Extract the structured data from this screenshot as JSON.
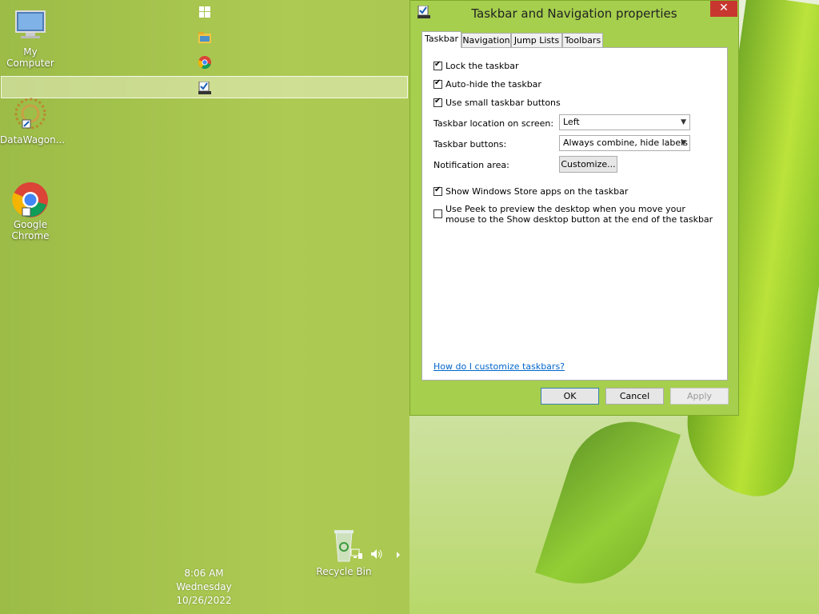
{
  "desktop": {
    "icons": [
      {
        "label": "My Computer"
      },
      {
        "label": "DataWagon..."
      },
      {
        "label": "Google Chrome"
      },
      {
        "label": "Recycle Bin"
      }
    ]
  },
  "taskbar": {
    "clock": {
      "time": "8:06 AM",
      "day": "Wednesday",
      "date": "10/26/2022"
    }
  },
  "dialog": {
    "title": "Taskbar and Navigation properties",
    "close_label": "✕",
    "tabs": [
      {
        "label": "Taskbar"
      },
      {
        "label": "Navigation"
      },
      {
        "label": "Jump Lists"
      },
      {
        "label": "Toolbars"
      }
    ],
    "options": {
      "lock": {
        "label": "Lock the taskbar",
        "checked": true
      },
      "autohide": {
        "label": "Auto-hide the taskbar",
        "checked": true
      },
      "small": {
        "label": "Use small taskbar buttons",
        "checked": true
      },
      "store_apps": {
        "label": "Show Windows Store apps on the taskbar",
        "checked": true
      },
      "peek": {
        "label": "Use Peek to preview the desktop when you move your mouse to the Show desktop button at the end of the taskbar",
        "checked": false
      }
    },
    "location": {
      "label": "Taskbar location on screen:",
      "value": "Left"
    },
    "buttons_setting": {
      "label": "Taskbar buttons:",
      "value": "Always combine, hide labels"
    },
    "notification": {
      "label": "Notification area:",
      "button": "Customize..."
    },
    "help_link": "How do I customize taskbars?",
    "footer": {
      "ok": "OK",
      "cancel": "Cancel",
      "apply": "Apply"
    }
  }
}
